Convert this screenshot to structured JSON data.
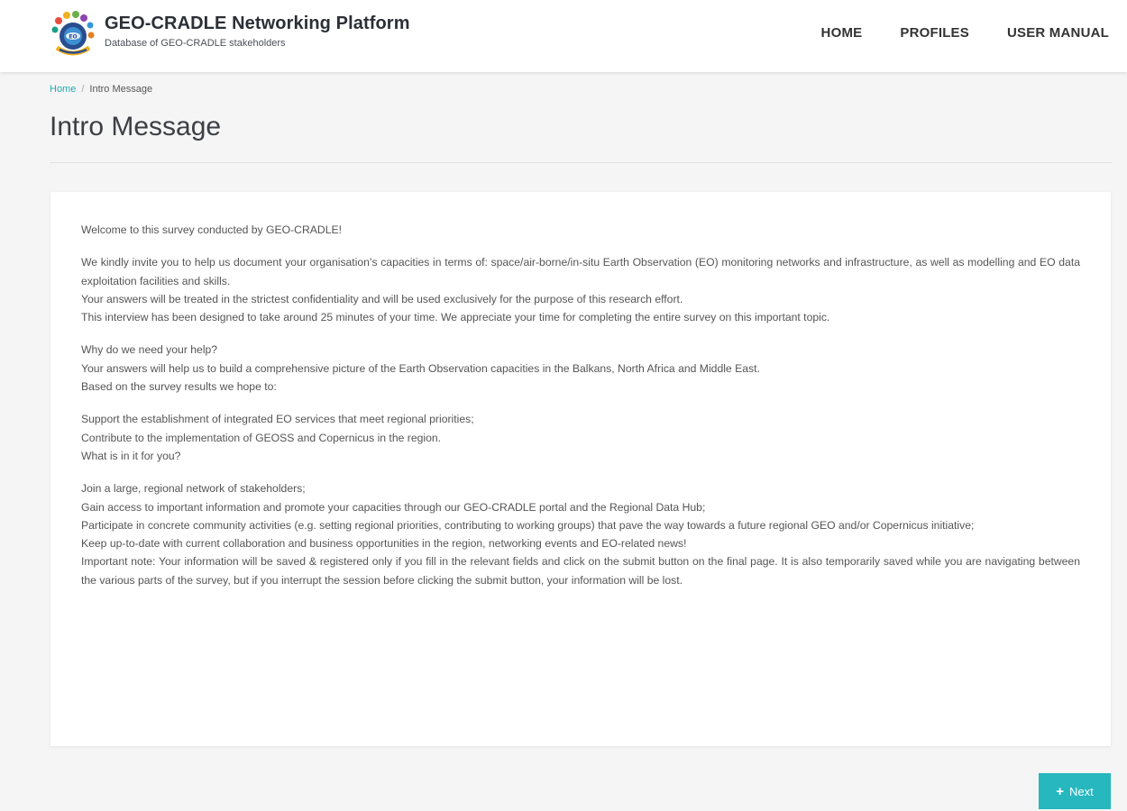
{
  "header": {
    "title": "GEO-CRADLE Networking Platform",
    "subtitle": "Database of GEO-CRADLE stakeholders",
    "logo_icon": "geo-cradle-logo-icon",
    "nav": [
      {
        "label": "HOME"
      },
      {
        "label": "PROFILES"
      },
      {
        "label": "USER MANUAL"
      }
    ]
  },
  "breadcrumb": {
    "home": "Home",
    "separator": "/",
    "current": "Intro Message"
  },
  "page": {
    "title": "Intro Message"
  },
  "intro": {
    "p1": [
      "Welcome to this survey conducted by GEO-CRADLE!"
    ],
    "p2": [
      "We kindly invite you to help us document your organisation’s capacities in terms of: space/air-borne/in-situ Earth Observation (EO) monitoring networks and infrastructure, as well as modelling and EO data exploitation facilities and skills.",
      "Your answers will be treated in the strictest confidentiality and will be used exclusively for the purpose of this research effort.",
      "This interview has been designed to take around 25 minutes of your time. We appreciate your time for completing the entire survey on this important topic."
    ],
    "p3": [
      "Why do we need your help?",
      "Your answers will help us to build a comprehensive picture of the Earth Observation capacities in the Balkans, North Africa and Middle East.",
      "Based on the survey results we hope to:"
    ],
    "p4": [
      "Support the establishment of integrated EO services that meet regional priorities;",
      "Contribute to the implementation of GEOSS and Copernicus in the region.",
      "What is in it for you?"
    ],
    "p5": [
      "Join a large, regional network of stakeholders;",
      "Gain access to important information and promote your capacities through our GEO-CRADLE portal and the Regional Data Hub;",
      "Participate in concrete community activities (e.g. setting regional priorities, contributing to working groups) that pave the way towards a future regional GEO and/or Copernicus initiative;",
      "Keep up-to-date with current collaboration and business opportunities in the region, networking events and EO-related news!",
      "Important note: Your information will be saved & registered only if you fill in the relevant fields and click on the submit button on the final page. It is also temporarily saved while you are navigating between the various parts of the survey, but if you interrupt the session before clicking the submit button, your information will be lost."
    ]
  },
  "actions": {
    "next_label": "Next",
    "next_icon": "plus-icon"
  },
  "colors": {
    "accent": "#26b7bf",
    "link": "#26a9b5"
  }
}
